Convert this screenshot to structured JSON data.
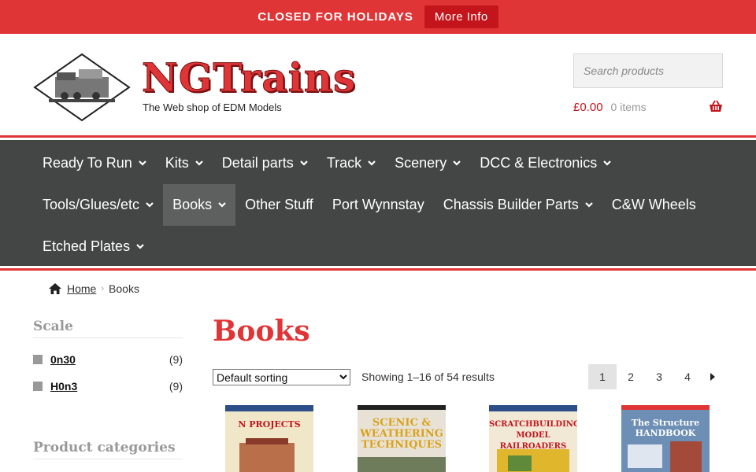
{
  "banner": {
    "text": "CLOSED FOR HOLIDAYS",
    "button": "More Info"
  },
  "header": {
    "logo_text": "NGTrains",
    "tagline": "The Web shop of EDM Models",
    "search_placeholder": "Search products",
    "cart_amount": "£0.00",
    "cart_items": "0 items"
  },
  "nav": {
    "row1": [
      {
        "label": "Ready To Run",
        "dropdown": true
      },
      {
        "label": "Kits",
        "dropdown": true
      },
      {
        "label": "Detail parts",
        "dropdown": true
      },
      {
        "label": "Track",
        "dropdown": true
      },
      {
        "label": "Scenery",
        "dropdown": true
      },
      {
        "label": "DCC & Electronics",
        "dropdown": true
      }
    ],
    "row2": [
      {
        "label": "Tools/Glues/etc",
        "dropdown": true
      },
      {
        "label": "Books",
        "dropdown": true,
        "active": true
      },
      {
        "label": "Other Stuff",
        "dropdown": false
      },
      {
        "label": "Port Wynnstay",
        "dropdown": false
      },
      {
        "label": "Chassis Builder Parts",
        "dropdown": true
      },
      {
        "label": "C&W Wheels",
        "dropdown": false
      }
    ],
    "row3": [
      {
        "label": "Etched Plates",
        "dropdown": true
      }
    ]
  },
  "breadcrumb": {
    "home": "Home",
    "current": "Books"
  },
  "sidebar": {
    "scale_title": "Scale",
    "scales": [
      {
        "label": "0n30",
        "count": "(9)"
      },
      {
        "label": "H0n3",
        "count": "(9)"
      }
    ],
    "categories_title": "Product categories"
  },
  "main": {
    "title": "Books",
    "sort_selected": "Default sorting",
    "result_count": "Showing 1–16 of 54 results",
    "pages": [
      "1",
      "2",
      "3",
      "4"
    ],
    "current_page": "1"
  },
  "products": [
    {
      "cover_text": "N PROJECTS",
      "cover_color": "#f0e6c8"
    },
    {
      "cover_text": "SCENIC & WEATHERING TECHNIQUES",
      "cover_color": "#e8e2d6"
    },
    {
      "cover_text": "SCRATCHBUILDING MODEL RAILROADERS",
      "cover_color": "#f1e9d6"
    },
    {
      "cover_text": "The Structure HANDBOOK",
      "cover_color": "#6e8fb5"
    }
  ],
  "colors": {
    "accent": "#e03537",
    "nav_bg": "#444545",
    "nav_active": "#5e5f5f"
  }
}
